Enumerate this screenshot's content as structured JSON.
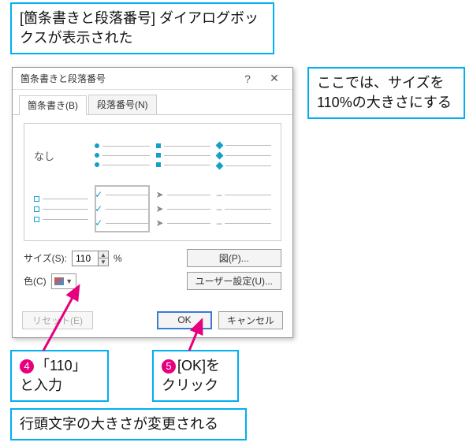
{
  "callouts": {
    "top": "[箇条書きと段落番号] ダイアログボックスが表示された",
    "right": "ここでは、サイズを110%の大きさにする",
    "step4_num": "4",
    "step4_text": "「110」と入力",
    "step5_num": "5",
    "step5_text": "[OK]をクリック",
    "bottom": "行頭文字の大きさが変更される"
  },
  "dialog": {
    "title": "箇条書きと段落番号",
    "tabs": {
      "active": "箇条書き(B)",
      "other": "段落番号(N)"
    },
    "none_label": "なし",
    "size_label": "サイズ(S):",
    "size_value": "110",
    "percent": "%",
    "color_label": "色(C)",
    "picture_btn": "図(P)...",
    "customize_btn": "ユーザー設定(U)...",
    "reset_btn": "リセット(E)",
    "ok_btn": "OK",
    "cancel_btn": "キャンセル"
  }
}
